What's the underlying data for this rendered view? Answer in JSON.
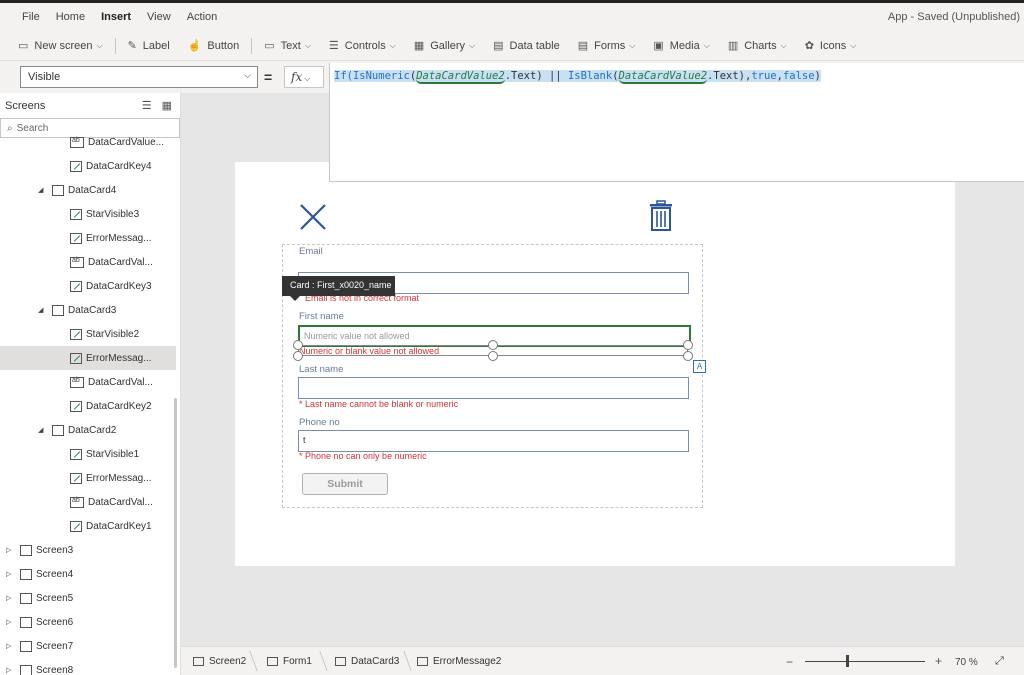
{
  "menu": {
    "items": [
      "File",
      "Home",
      "Insert",
      "View",
      "Action"
    ],
    "active": "Insert",
    "app_status": "App - Saved (Unpublished)"
  },
  "toolbar": {
    "new_screen": "New screen",
    "label": "Label",
    "button": "Button",
    "text": "Text",
    "controls": "Controls",
    "gallery": "Gallery",
    "data_table": "Data table",
    "forms": "Forms",
    "media": "Media",
    "charts": "Charts",
    "icons": "Icons"
  },
  "formula_bar": {
    "property": "Visible",
    "fx": "fx",
    "formula_parts": {
      "p1": "If(",
      "p2": "IsNumeric",
      "p3": "(",
      "p4": "DataCardValue2",
      "p5": ".Text) || ",
      "p6": "IsBlank",
      "p7": "(",
      "p8": "DataCardValue2",
      "p9": ".Text),",
      "p10": "true",
      "p11": ",",
      "p12": "false",
      "p13": ")"
    }
  },
  "sidebar": {
    "title": "Screens",
    "search_placeholder": "Search",
    "tree": [
      {
        "label": "DataCardValue...",
        "type": "input",
        "indent": 2,
        "partial": true
      },
      {
        "label": "DataCardKey4",
        "type": "edit",
        "indent": 2
      },
      {
        "label": "DataCard4",
        "type": "card",
        "indent": 1,
        "expanded": true
      },
      {
        "label": "StarVisible3",
        "type": "edit",
        "indent": 2
      },
      {
        "label": "ErrorMessag...",
        "type": "edit",
        "indent": 2
      },
      {
        "label": "DataCardVal...",
        "type": "input",
        "indent": 2
      },
      {
        "label": "DataCardKey3",
        "type": "edit",
        "indent": 2
      },
      {
        "label": "DataCard3",
        "type": "card",
        "indent": 1,
        "expanded": true
      },
      {
        "label": "StarVisible2",
        "type": "edit",
        "indent": 2
      },
      {
        "label": "ErrorMessag...",
        "type": "edit",
        "indent": 2,
        "selected": true
      },
      {
        "label": "DataCardVal...",
        "type": "input",
        "indent": 2
      },
      {
        "label": "DataCardKey2",
        "type": "edit",
        "indent": 2
      },
      {
        "label": "DataCard2",
        "type": "card",
        "indent": 1,
        "expanded": true
      },
      {
        "label": "StarVisible1",
        "type": "edit",
        "indent": 2
      },
      {
        "label": "ErrorMessag...",
        "type": "edit",
        "indent": 2
      },
      {
        "label": "DataCardVal...",
        "type": "input",
        "indent": 2
      },
      {
        "label": "DataCardKey1",
        "type": "edit",
        "indent": 2
      },
      {
        "label": "Screen3",
        "type": "screen",
        "indent": 0
      },
      {
        "label": "Screen4",
        "type": "screen",
        "indent": 0
      },
      {
        "label": "Screen5",
        "type": "screen",
        "indent": 0
      },
      {
        "label": "Screen6",
        "type": "screen",
        "indent": 0
      },
      {
        "label": "Screen7",
        "type": "screen",
        "indent": 0
      },
      {
        "label": "Screen8",
        "type": "screen",
        "indent": 0
      }
    ]
  },
  "form": {
    "tooltip": "Card : First_x0020_name",
    "email_label": "Email",
    "email_value": "",
    "email_error": "Email is not in correct format",
    "first_name_label": "First name",
    "first_name_placeholder": "Numeric value not allowed",
    "first_name_error": "Numeric or blank value not allowed",
    "last_name_label": "Last name",
    "last_name_value": "",
    "last_name_error": "* Last name cannot be blank or numeric",
    "phone_label": "Phone no",
    "phone_value": "t",
    "phone_error": "* Phone no can only be numeric",
    "submit": "Submit",
    "corner_badge": "A"
  },
  "statusbar": {
    "crumbs": [
      "Screen2",
      "Form1",
      "DataCard3",
      "ErrorMessage2"
    ],
    "zoom_minus": "−",
    "zoom_plus": "+",
    "zoom": "70 %",
    "zoom_level": 0.35
  }
}
